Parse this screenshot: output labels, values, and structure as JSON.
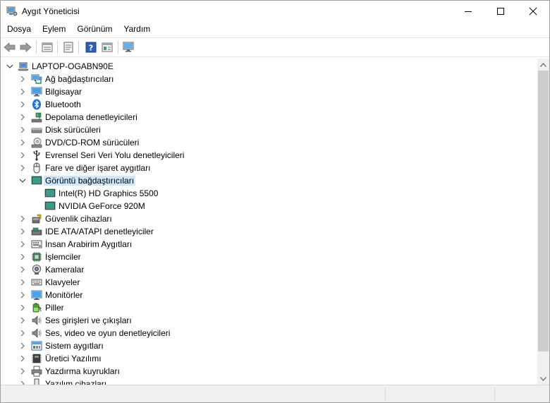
{
  "window": {
    "title": "Aygıt Yöneticisi",
    "controls": [
      "minimize-icon",
      "maximize-icon",
      "close-icon"
    ]
  },
  "menu": [
    "Dosya",
    "Eylem",
    "Görünüm",
    "Yardım"
  ],
  "toolbar": [
    "back-arrow-icon",
    "forward-arrow-icon",
    "device-view-icon",
    "properties-icon",
    "help-icon",
    "resource-view-icon",
    "scan-hardware-icon"
  ],
  "tree": {
    "root": "LAPTOP-OGABN90E",
    "items": [
      {
        "label": "Ağ bağdaştırıcıları",
        "icon": "network-adapter-icon",
        "expanded": false
      },
      {
        "label": "Bilgisayar",
        "icon": "computer-icon",
        "expanded": false
      },
      {
        "label": "Bluetooth",
        "icon": "bluetooth-icon",
        "expanded": false
      },
      {
        "label": "Depolama denetleyicileri",
        "icon": "storage-controller-icon",
        "expanded": false
      },
      {
        "label": "Disk sürücüleri",
        "icon": "disk-drive-icon",
        "expanded": false
      },
      {
        "label": "DVD/CD-ROM sürücüleri",
        "icon": "dvd-drive-icon",
        "expanded": false
      },
      {
        "label": "Evrensel Seri Veri Yolu denetleyicileri",
        "icon": "usb-icon",
        "expanded": false
      },
      {
        "label": "Fare ve diğer işaret aygıtları",
        "icon": "mouse-icon",
        "expanded": false
      },
      {
        "label": "Görüntü bağdaştırıcıları",
        "icon": "display-adapter-icon",
        "expanded": true,
        "selected": true,
        "children": [
          {
            "label": "Intel(R) HD Graphics 5500",
            "icon": "display-adapter-icon"
          },
          {
            "label": "NVIDIA GeForce 920M",
            "icon": "display-adapter-icon"
          }
        ]
      },
      {
        "label": "Güvenlik cihazları",
        "icon": "security-device-icon",
        "expanded": false
      },
      {
        "label": "IDE ATA/ATAPI denetleyiciler",
        "icon": "ide-controller-icon",
        "expanded": false
      },
      {
        "label": "İnsan Arabirim Aygıtları",
        "icon": "hid-icon",
        "expanded": false
      },
      {
        "label": "İşlemciler",
        "icon": "processor-icon",
        "expanded": false
      },
      {
        "label": "Kameralar",
        "icon": "camera-icon",
        "expanded": false
      },
      {
        "label": "Klavyeler",
        "icon": "keyboard-icon",
        "expanded": false
      },
      {
        "label": "Monitörler",
        "icon": "monitor-icon",
        "expanded": false
      },
      {
        "label": "Piller",
        "icon": "battery-icon",
        "expanded": false
      },
      {
        "label": "Ses girişleri ve çıkışları",
        "icon": "speaker-icon",
        "expanded": false
      },
      {
        "label": "Ses, video ve oyun denetleyicileri",
        "icon": "speaker-icon",
        "expanded": false
      },
      {
        "label": "Sistem aygıtları",
        "icon": "system-device-icon",
        "expanded": false
      },
      {
        "label": "Üretici Yazılımı",
        "icon": "firmware-icon",
        "expanded": false
      },
      {
        "label": "Yazdırma kuyrukları",
        "icon": "printer-icon",
        "expanded": false
      },
      {
        "label": "Yazılım cihazları",
        "icon": "software-device-icon",
        "expanded": false
      }
    ]
  },
  "colors": {
    "selection": "#cce8ff",
    "accent_blue": "#2a78c6",
    "monitor_green": "#3a9b8a"
  }
}
